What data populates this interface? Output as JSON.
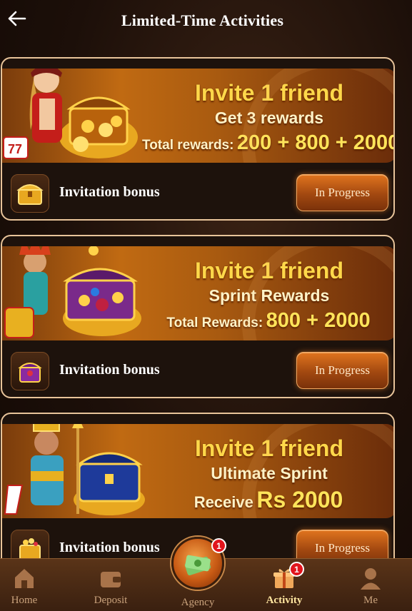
{
  "header": {
    "title": "Limited-Time Activities",
    "back_icon": "arrow-left-icon"
  },
  "activities": [
    {
      "line1": "Invite 1 friend",
      "line2": "Get 3 rewards",
      "line3_small": "Total rewards:",
      "line3_big": "200 + 800 + 2000",
      "label": "Invitation bonus",
      "status": "In Progress",
      "icon": "treasure-chest-icon"
    },
    {
      "line1": "Invite 1 friend",
      "line2": "Sprint Rewards",
      "line3_small": "Total Rewards:",
      "line3_big": "800 + 2000",
      "label": "Invitation bonus",
      "status": "In Progress",
      "icon": "gem-chest-icon"
    },
    {
      "line1": "Invite 1 friend",
      "line2": "Ultimate Sprint",
      "line3_small": "Receive",
      "line3_big": "Rs 2000",
      "label": "Invitation bonus",
      "status": "In Progress",
      "icon": "gold-chest-icon"
    }
  ],
  "tabbar": {
    "home": "Home",
    "deposit": "Deposit",
    "agency": "Agency",
    "agency_badge": "1",
    "activity": "Activity",
    "activity_badge": "1",
    "me": "Me",
    "active": "Activity"
  },
  "colors": {
    "accent": "#e0741e",
    "gold": "#ffd84a",
    "badge": "#e2141c"
  }
}
